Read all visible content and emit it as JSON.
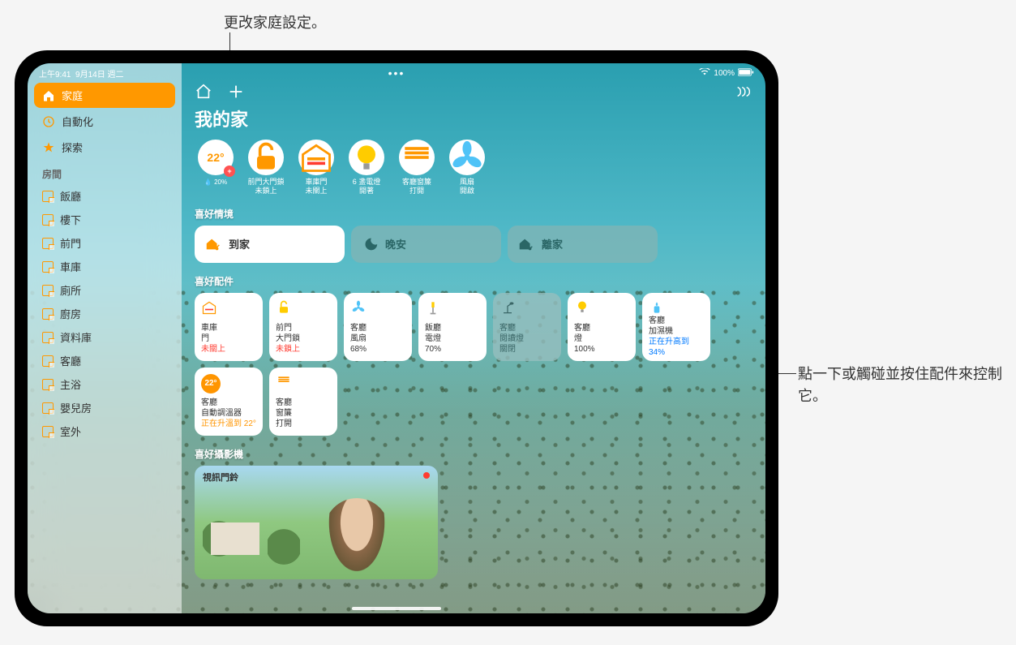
{
  "callouts": {
    "top": "更改家庭設定。",
    "right": "點一下或觸碰並按住配件來控制它。"
  },
  "statusbar": {
    "time": "上午9:41",
    "date": "9月14日 週二",
    "battery": "100%"
  },
  "sidebar": {
    "nav": [
      {
        "label": "家庭",
        "icon": "home",
        "active": true
      },
      {
        "label": "自動化",
        "icon": "clock",
        "active": false
      },
      {
        "label": "探索",
        "icon": "star",
        "active": false
      }
    ],
    "rooms_header": "房間",
    "rooms": [
      "飯廳",
      "樓下",
      "前門",
      "車庫",
      "廁所",
      "廚房",
      "資料庫",
      "客廳",
      "主浴",
      "嬰兒房",
      "室外"
    ]
  },
  "main": {
    "title": "我的家",
    "climate": {
      "temp": "22°",
      "rain": "20%"
    },
    "status_circles": [
      {
        "icon": "lock",
        "line1": "前門大門鎖",
        "line2": "未鎖上"
      },
      {
        "icon": "garage",
        "line1": "車庫門",
        "line2": "未關上"
      },
      {
        "icon": "bulb",
        "line1": "6 盞電燈",
        "line2": "開著"
      },
      {
        "icon": "blinds",
        "line1": "客廳窗簾",
        "line2": "打開"
      },
      {
        "icon": "fan",
        "line1": "風扇",
        "line2": "開啟"
      }
    ],
    "scenes_header": "喜好情境",
    "scenes": [
      {
        "label": "到家",
        "icon": "arrive",
        "tone": "light"
      },
      {
        "label": "晚安",
        "icon": "moon",
        "tone": "dim"
      },
      {
        "label": "離家",
        "icon": "leave",
        "tone": "dim"
      }
    ],
    "acc_header": "喜好配件",
    "accessories": [
      {
        "icon": "garage",
        "room": "車庫",
        "name": "門",
        "status": "未關上",
        "status_color": "red",
        "tone": "light"
      },
      {
        "icon": "lock",
        "room": "前門",
        "name": "大門鎖",
        "status": "未鎖上",
        "status_color": "red",
        "tone": "light"
      },
      {
        "icon": "fan",
        "room": "客廳",
        "name": "風扇",
        "status": "68%",
        "status_color": "",
        "tone": "light"
      },
      {
        "icon": "lamp",
        "room": "飯廳",
        "name": "電燈",
        "status": "70%",
        "status_color": "",
        "tone": "light"
      },
      {
        "icon": "desk-lamp",
        "room": "客廳",
        "name": "閱讀燈",
        "status": "關閉",
        "status_color": "",
        "tone": "dim"
      },
      {
        "icon": "bulb",
        "room": "客廳",
        "name": "燈",
        "status": "100%",
        "status_color": "",
        "tone": "light"
      },
      {
        "icon": "humidifier",
        "room": "客廳",
        "name": "加濕機",
        "status": "正在升高到 34%",
        "status_color": "blue",
        "tone": "light"
      },
      {
        "icon": "thermo",
        "room": "客廳",
        "name": "自動調溫器",
        "status": "正在升溫到 22°",
        "status_color": "orange",
        "tone": "light",
        "thermo_val": "22°"
      },
      {
        "icon": "blinds",
        "room": "客廳",
        "name": "窗簾",
        "status": "打開",
        "status_color": "",
        "tone": "light"
      }
    ],
    "camera_header": "喜好攝影機",
    "camera_name": "視訊門鈴"
  }
}
